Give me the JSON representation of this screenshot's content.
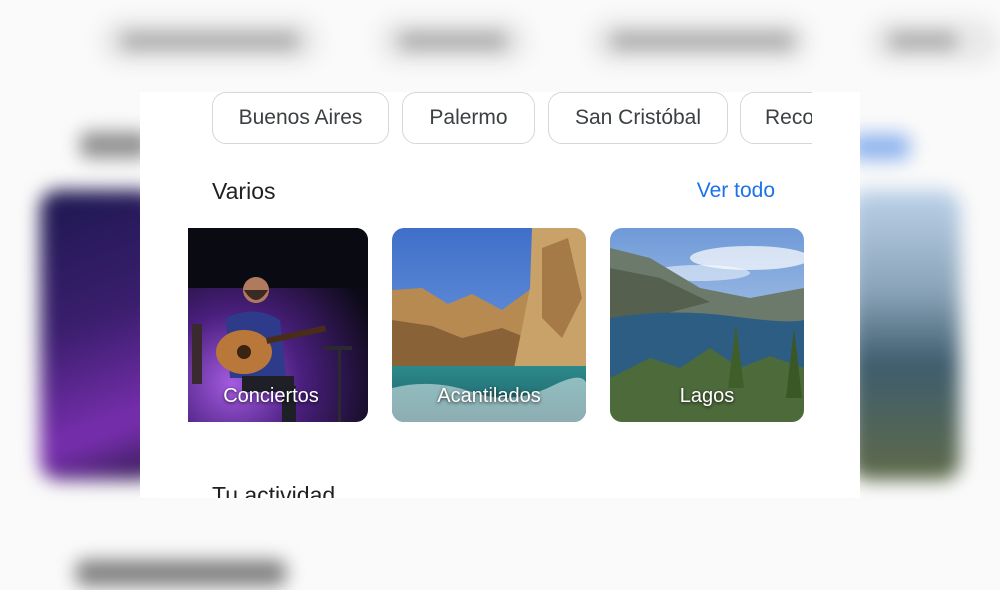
{
  "chips": [
    {
      "label": "Buenos Aires"
    },
    {
      "label": "Palermo"
    },
    {
      "label": "San Cristóbal"
    },
    {
      "label": "Recoleta"
    }
  ],
  "varios": {
    "title": "Varios",
    "see_all_label": "Ver todo",
    "cards": [
      {
        "label": "Conciertos",
        "icon": "concert-photo"
      },
      {
        "label": "Acantilados",
        "icon": "cliffs-photo"
      },
      {
        "label": "Lagos",
        "icon": "lake-photo"
      }
    ]
  },
  "activity": {
    "title": "Tu actividad"
  },
  "colors": {
    "link": "#1a73e8",
    "text_primary": "#202124",
    "chip_border": "#d5d7da"
  }
}
